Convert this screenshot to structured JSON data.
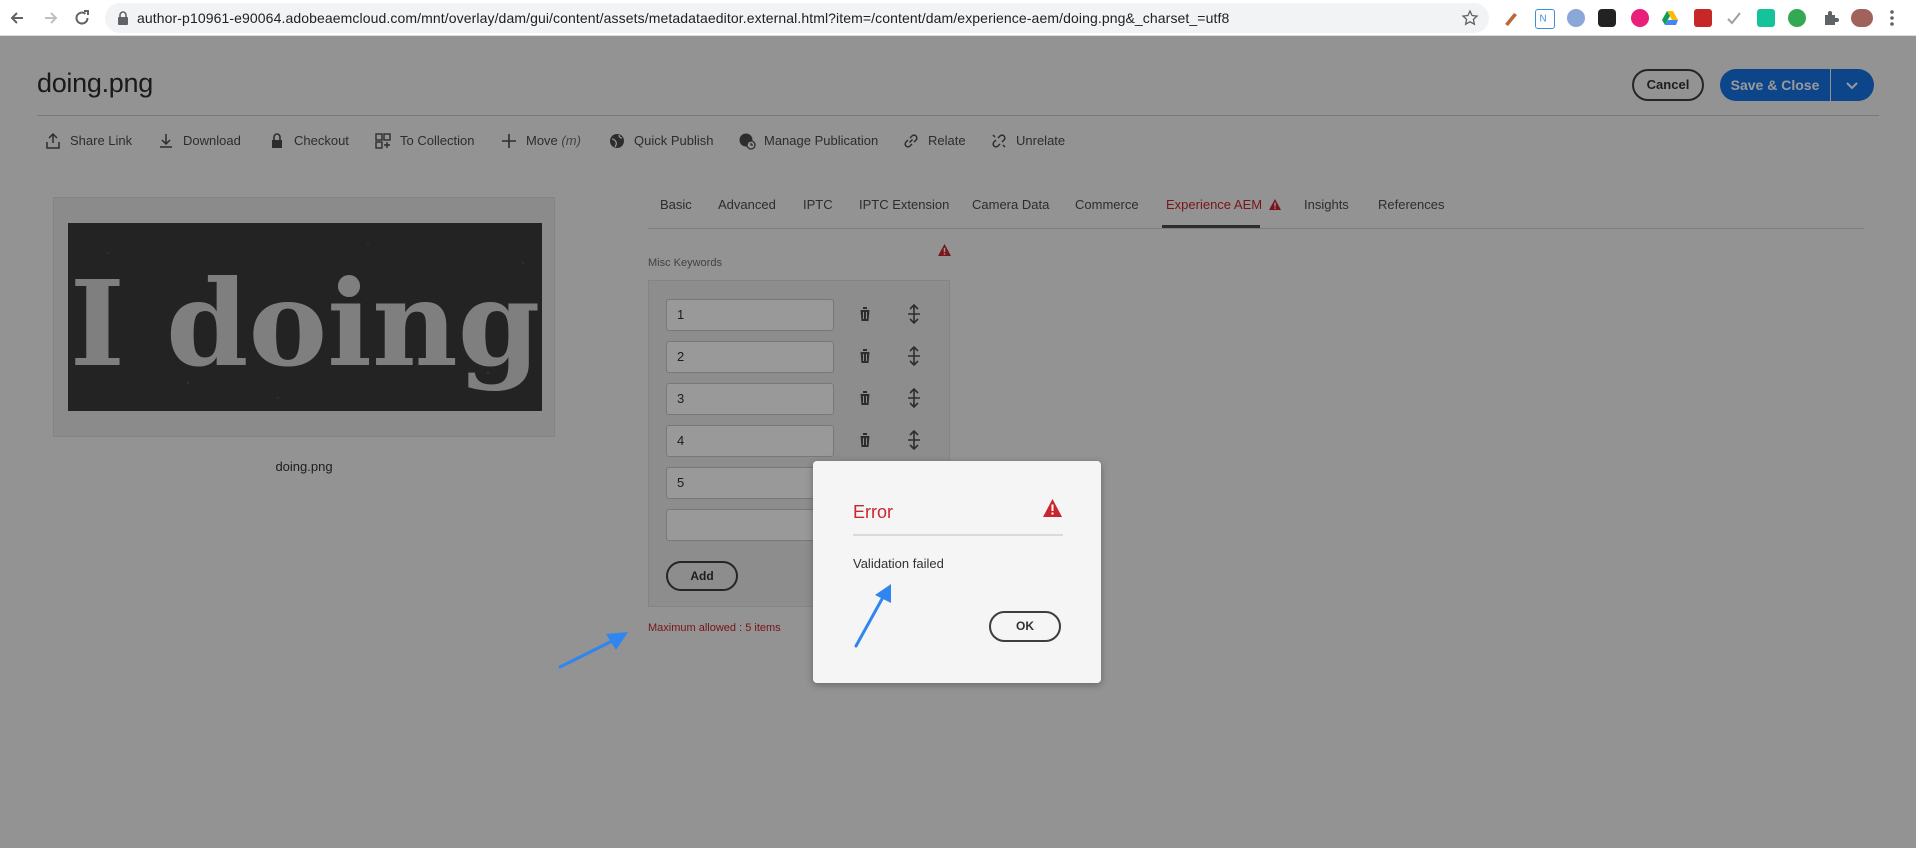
{
  "browser": {
    "url": "author-p10961-e90064.adobeaemcloud.com/mnt/overlay/dam/gui/content/assets/metadataeditor.external.html?item=/content/dam/experience-aem/doing.png&_charset_=utf8"
  },
  "header": {
    "title": "doing.png",
    "cancel_label": "Cancel",
    "save_label": "Save & Close"
  },
  "toolbar": {
    "share": "Share Link",
    "download": "Download",
    "checkout": "Checkout",
    "to_collection": "To Collection",
    "move": "Move",
    "move_shortcut": "(m)",
    "quick_publish": "Quick Publish",
    "manage_publication": "Manage Publication",
    "relate": "Relate",
    "unrelate": "Unrelate"
  },
  "asset": {
    "thumbnail_text": "I doing",
    "name": "doing.png"
  },
  "tabs": [
    "Basic",
    "Advanced",
    "IPTC",
    "IPTC Extension",
    "Camera Data",
    "Commerce",
    "Experience AEM",
    "Insights",
    "References"
  ],
  "active_tab": "Experience AEM",
  "misc_keywords": {
    "label": "Misc Keywords",
    "items": [
      "1",
      "2",
      "3",
      "4",
      "5",
      ""
    ],
    "add_label": "Add",
    "error": "Maximum allowed : 5 items"
  },
  "dialog": {
    "title": "Error",
    "message": "Validation failed",
    "ok_label": "OK"
  },
  "colors": {
    "accent": "#1473e6",
    "error": "#c9252d"
  }
}
